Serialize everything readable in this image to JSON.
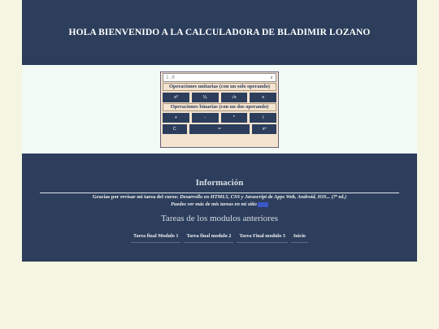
{
  "header": {
    "title": "HOLA BIENVENIDO A LA CALCULADORA DE BLADIMIR LOZANO"
  },
  "calculator": {
    "select_value": "1.0",
    "unary_title": "Operaciones unitarias (con un solo operando)",
    "unary_buttons": [
      "x²",
      "¹⁄ₓ",
      "√x",
      "x"
    ],
    "binary_title": "Operaciones binarias (con un dos operando)",
    "binary_buttons": [
      "+",
      "-",
      "*",
      "/"
    ],
    "bottom_buttons": [
      "C",
      "=",
      "xⁿ"
    ]
  },
  "footer": {
    "info_title": "Información",
    "thanks_prefix": "Gracias por revisar mi tarea del curso: ",
    "course": "Desarrollo en HTML5, CSS y Javascript de Apps Web, Android, IOS... (7ª ed.)",
    "more_text": "Puedes ver más de mis tareas en mi sitio",
    "tareas_title": "Tareas de los modulos anteriores",
    "links": [
      "Tarea final Modulo 1",
      "Tarea final modulo 2",
      "Tarea Final modulo 3",
      "Inicio"
    ]
  },
  "colors": {
    "navy": "#2c3e5c",
    "cream": "#f5f5e1",
    "calc_bg": "#f4e3cf",
    "band": "#f2fbf6"
  }
}
